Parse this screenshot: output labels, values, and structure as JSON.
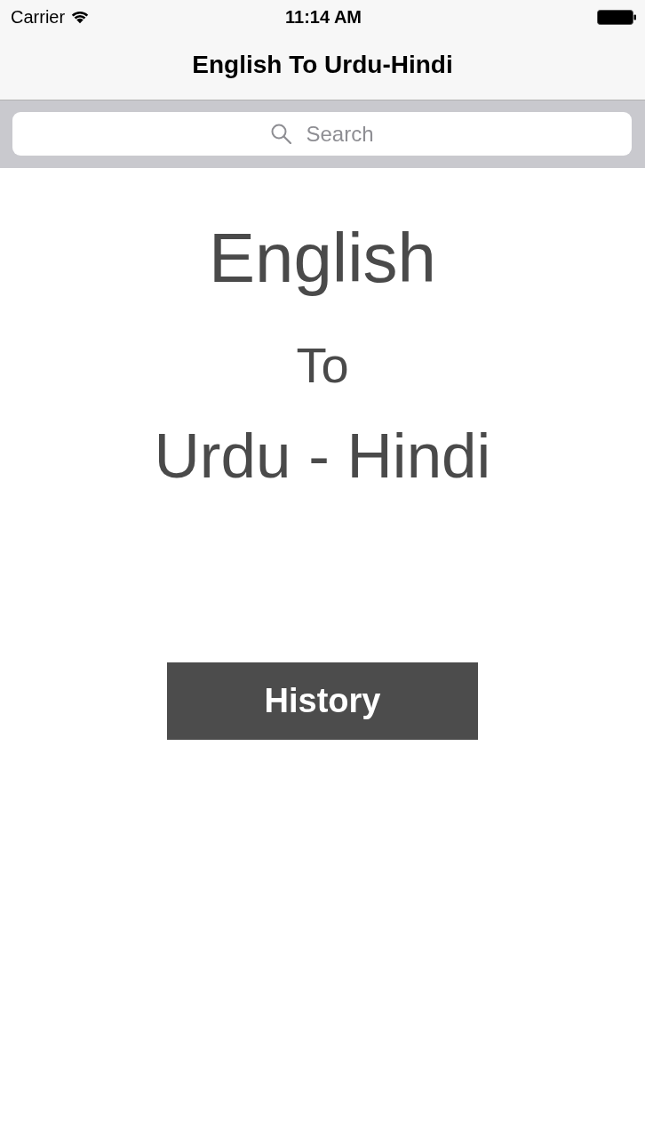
{
  "status_bar": {
    "carrier": "Carrier",
    "time": "11:14 AM"
  },
  "nav_bar": {
    "title": "English To Urdu-Hindi"
  },
  "search": {
    "placeholder": "Search"
  },
  "heading": {
    "lines": [
      "English",
      "To",
      "Urdu - Hindi"
    ]
  },
  "buttons": [
    {
      "label": "History"
    }
  ]
}
